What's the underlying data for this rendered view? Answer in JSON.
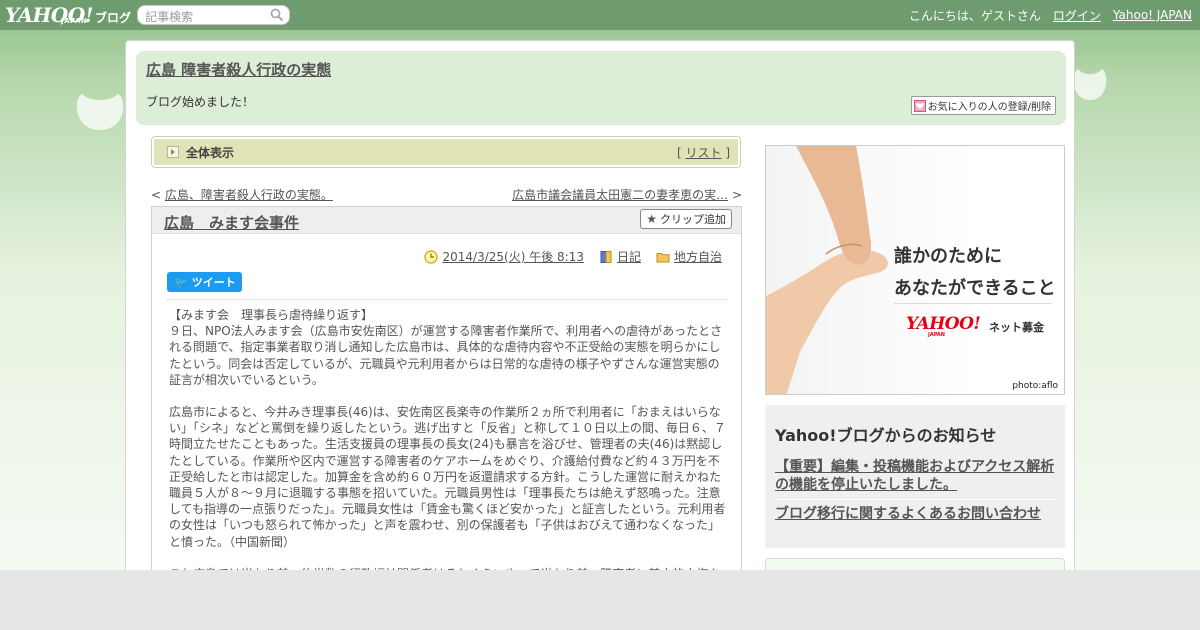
{
  "masthead": {
    "logo_main": "YAHOO!",
    "logo_sub": "JAPAN",
    "logo_blog": "ブログ",
    "search_placeholder": "記事検索",
    "greeting": "こんにちは、ゲストさん",
    "login_label": "ログイン",
    "yahoo_link": "Yahoo! JAPAN"
  },
  "header": {
    "blog_title": "広島 障害者殺人行政の実態",
    "description": "ブログ始めました！",
    "fav_button": "お気に入りの人の登録/削除"
  },
  "section_bar": {
    "label": "全体表示",
    "list_open": "[",
    "list_label": "リスト",
    "list_close": "]"
  },
  "pager": {
    "prev_prefix": "<",
    "prev_label": "広島、障害者殺人行政の実態。",
    "next_label": "広島市議会議員太田憲二の妻孝恵の実…",
    "next_suffix": ">"
  },
  "article": {
    "title": "広島　みます会事件",
    "clip_button": "クリップ追加",
    "date": "2014/3/25(火) 午後 8:13",
    "category": "日記",
    "folder": "地方自治",
    "tweet_label": "ツイート",
    "paragraphs": [
      "【みます会　理事長ら虐待繰り返す】\n９日、NPO法人みます会（広島市安佐南区）が運営する障害者作業所で、利用者への虐待があったとされる問題で、指定事業者取り消し通知した広島市は、具体的な虐待内容や不正受給の実態を明らかにしたという。同会は否定しているが、元職員や元利用者からは日常的な虐待の様子やずさんな運営実態の証言が相次いでいるという。",
      "広島市によると、今井みき理事長(46)は、安佐南区長楽寺の作業所２ヵ所で利用者に「おまえはいらない」「シネ」などと罵倒を繰り返したという。逃げ出すと「反省」と称して１０日以上の間、毎日６、７時間立たせたこともあった。生活支援員の理事長の長女(24)も暴言を浴びせ、管理者の夫(46)は黙認したとしている。作業所や区内で運営する障害者のケアホームをめぐり、介護給付費など約４３万円を不正受給したと市は認定した。加算金を含め約６０万円を返還請求する方針。こうした運営に耐えかねた職員５人が８～９月に退職する事態を招いていた。元職員男性は「理事長たちは絶えず怒鳴った。注意しても指導の一点張りだった」。元職員女性は「賃金も驚くほど安かった」と証言したという。元利用者の女性は「いつも怒られて怖かった」と声を震わせ、別の保護者も「子供はおびえて通わなくなった」と憤った。（中国新聞）",
      "これ広島では当たり前。約半数の行政福祉関係者はそれぐらいやって当たり前。障害者に基本的人権を"
    ]
  },
  "ad": {
    "line1": "誰かのために",
    "line2": "あなたができること",
    "logo": "YAHOO!",
    "logo_sub": "JAPAN",
    "tag": "ネット募金",
    "credit": "photo:aflo"
  },
  "notice": {
    "title": "Yahoo!ブログからのお知らせ",
    "link1": "【重要】編集・投稿機能およびアクセス解析の機能を停止いたしました。",
    "link2": "ブログ移行に関するよくあるお問い合わせ"
  },
  "colors": {
    "masthead": "#6f9c6f",
    "header_bg": "#ddeed8",
    "section_bar": "#e2e2b7",
    "tweet": "#1d9bf0",
    "ad_logo": "#e60012"
  }
}
